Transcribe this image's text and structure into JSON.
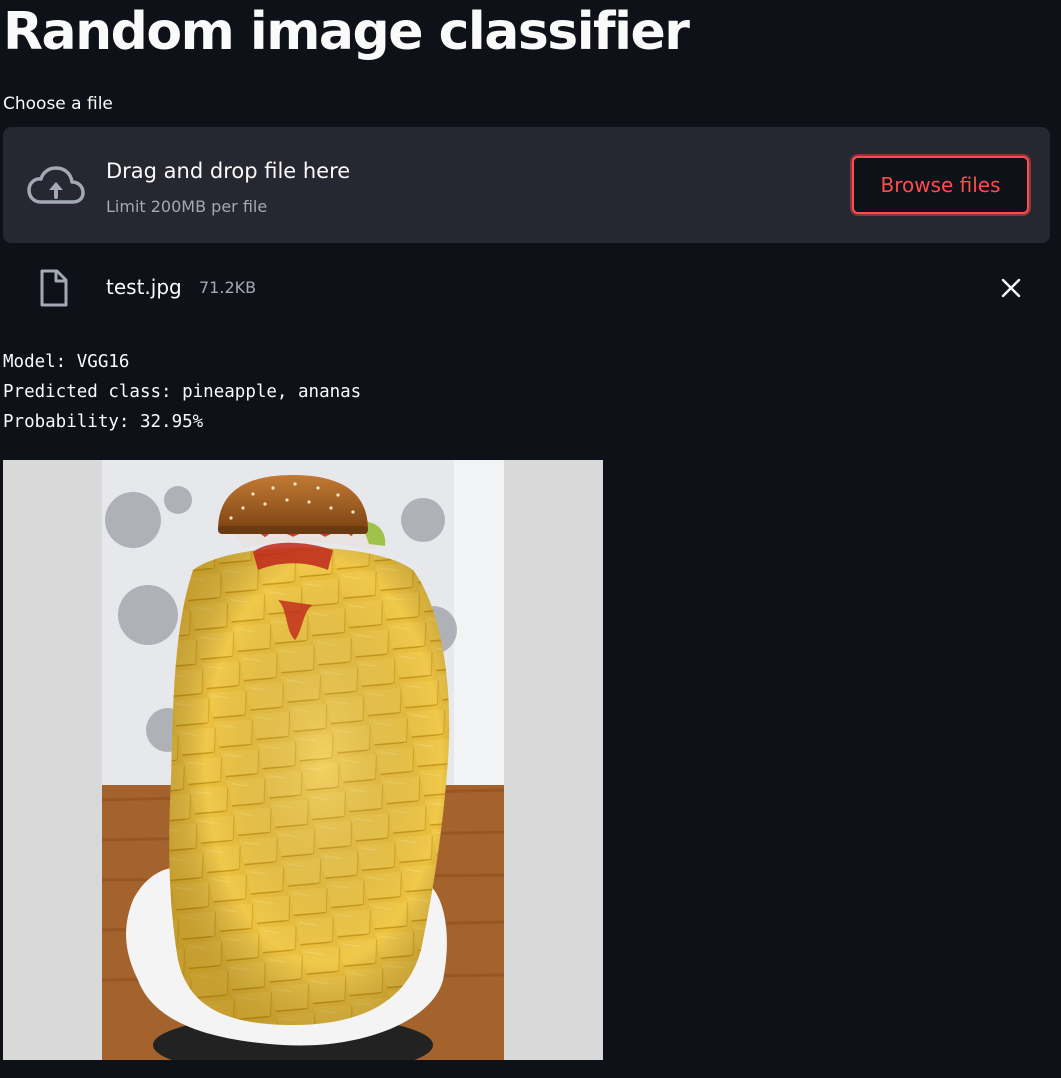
{
  "app": {
    "title": "Random image classifier"
  },
  "uploader": {
    "label": "Choose a file",
    "drop_text": "Drag and drop file here",
    "limit_text": "Limit 200MB per file",
    "browse_label": "Browse files",
    "icon": "cloud-upload-icon"
  },
  "file": {
    "name": "test.jpg",
    "size": "71.2KB",
    "icon": "file-icon",
    "remove_icon": "close-icon"
  },
  "result": {
    "model_line": "Model: VGG16",
    "class_line": "Predicted class: pineapple, ananas",
    "probability_line": "Probability: 32.95%"
  },
  "colors": {
    "background": "#0e1117",
    "dropzone": "#262730",
    "accent": "#ff4b4b",
    "muted_text": "#a3a8b4"
  }
}
